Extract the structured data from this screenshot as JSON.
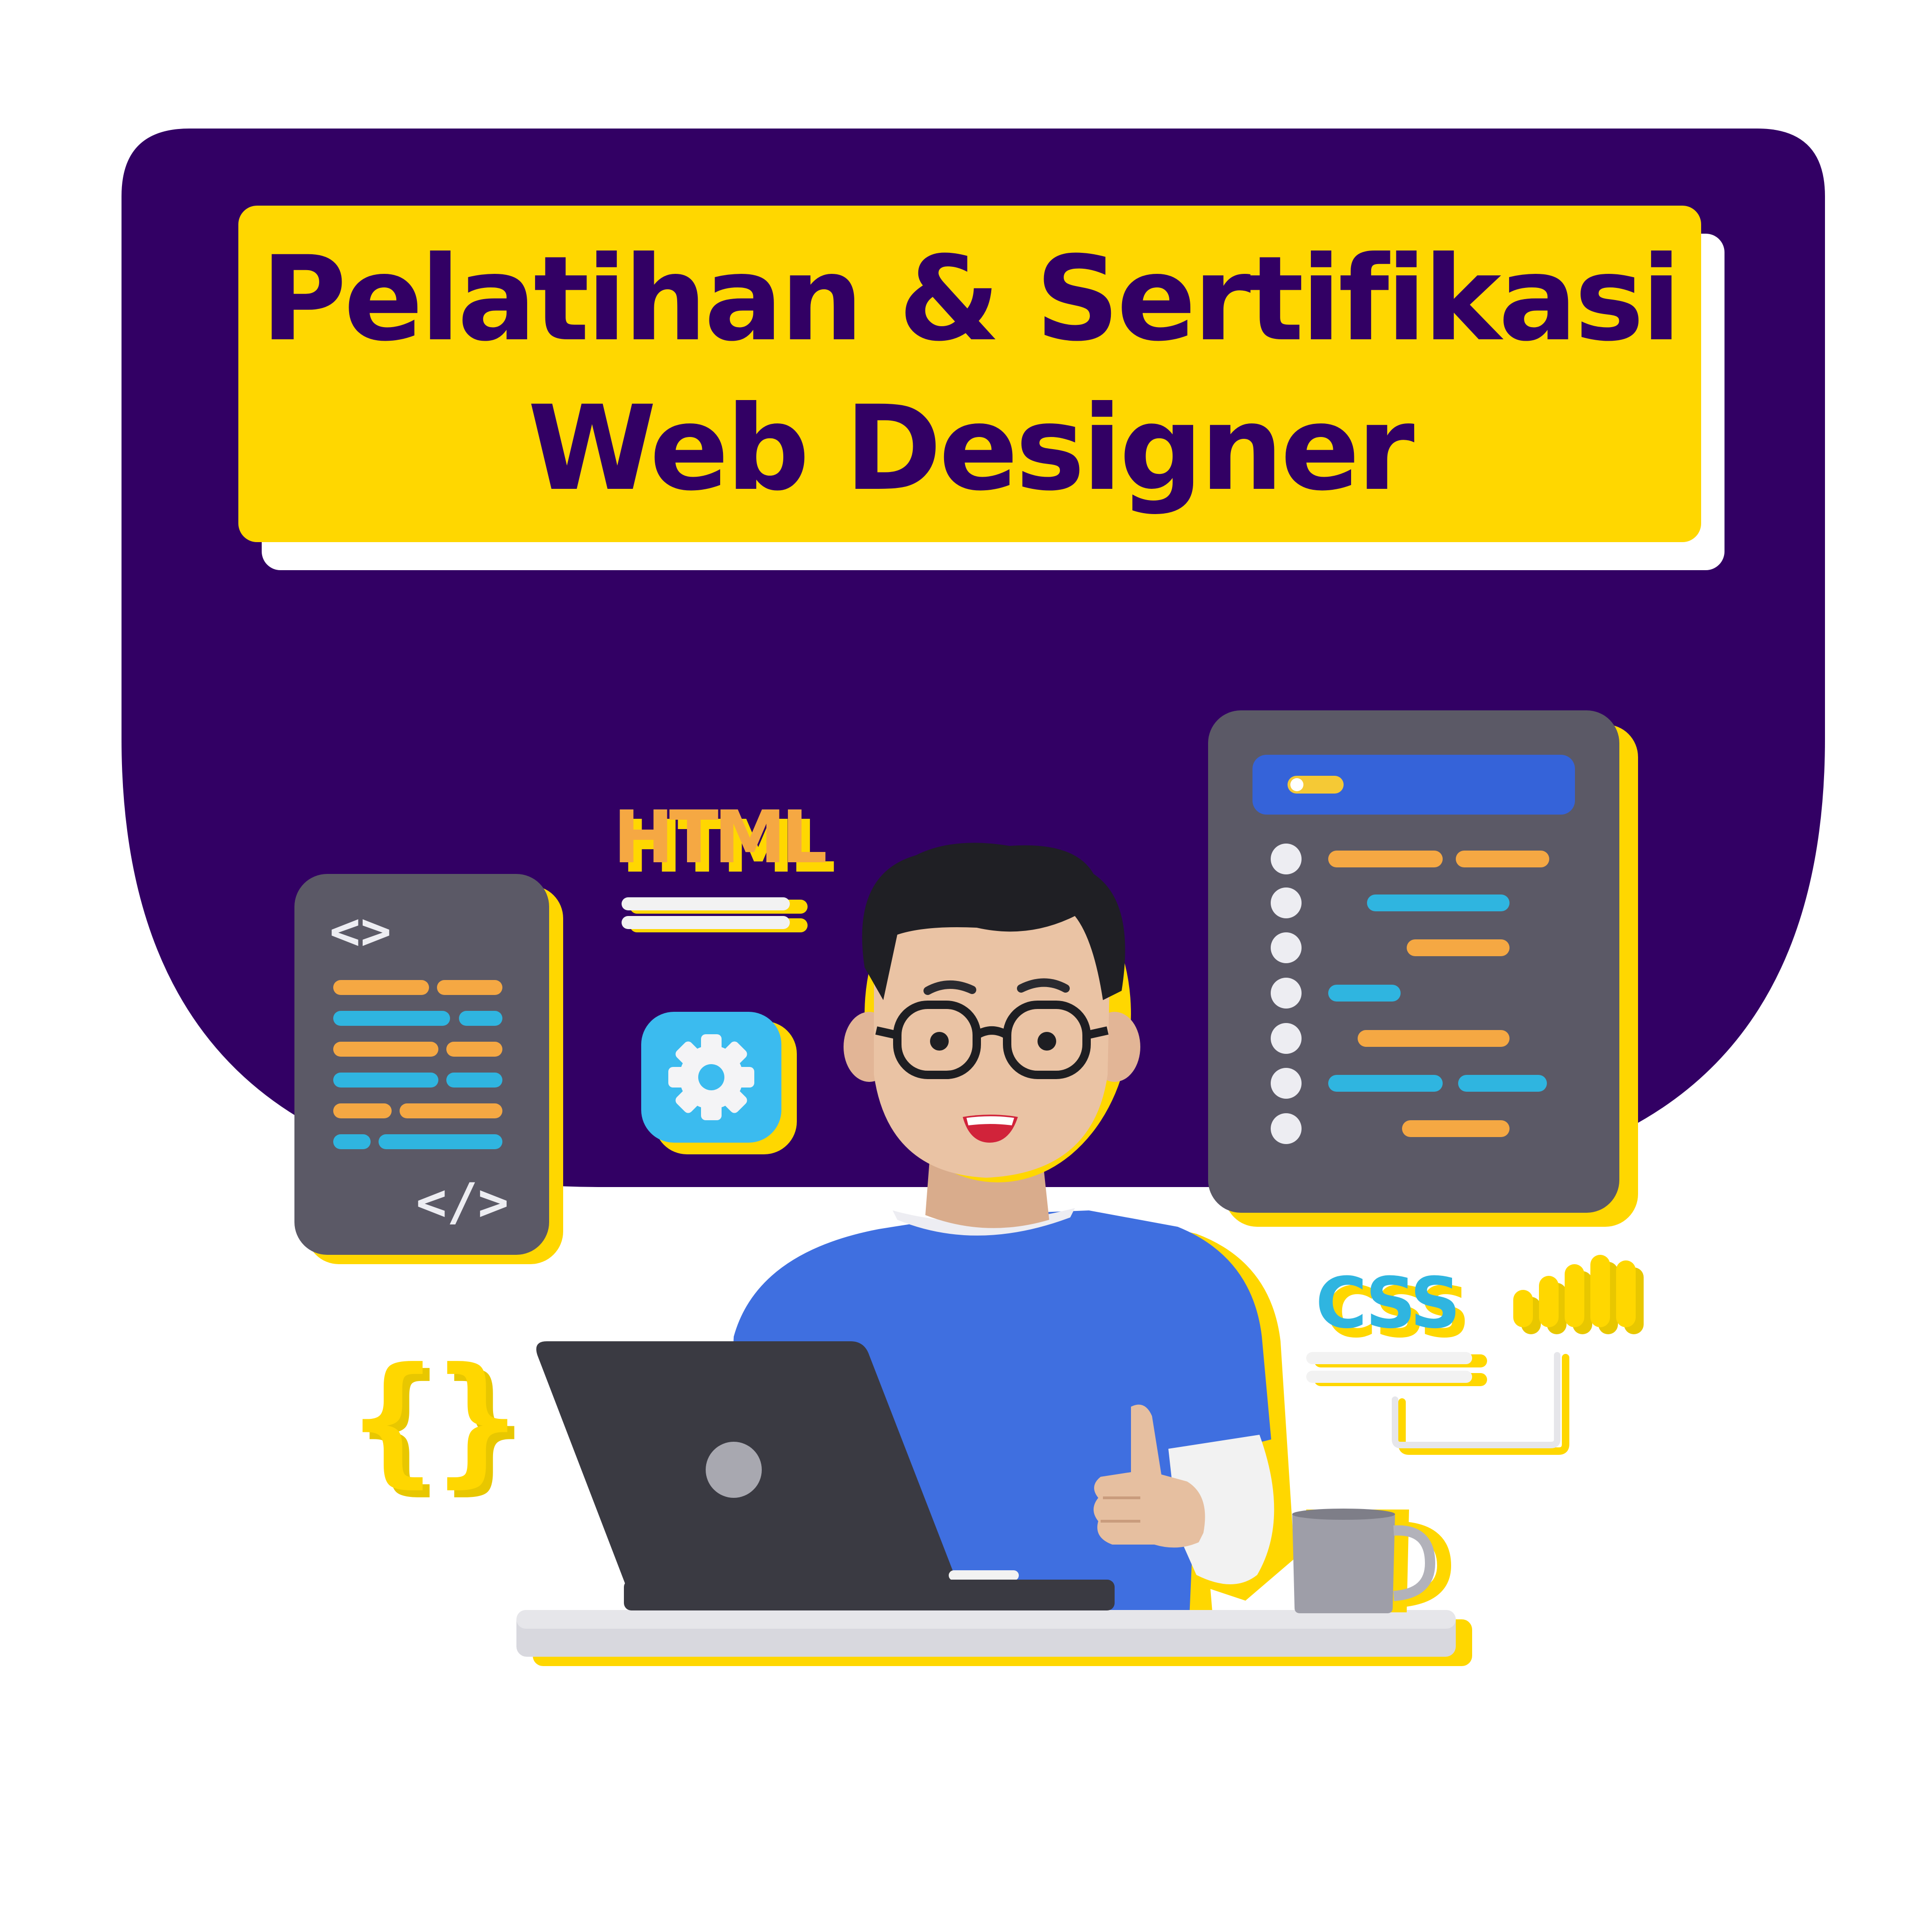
{
  "title": {
    "line1": "Pelatihan & Sertifikasi",
    "line2": "Web Designer"
  },
  "labels": {
    "html": "HTML",
    "css": "CSS",
    "left_code_open": "<>",
    "left_code_close": "</>",
    "braces": "{}"
  },
  "colors": {
    "purple": "#320064",
    "yellow": "#FFD700",
    "orange_code": "#F5A843",
    "blue_code": "#2FB5E0",
    "panel_gray": "#5B5966",
    "shirt_blue": "#3F6FE0",
    "gear_blue": "#3BBBEF",
    "laptop_dark": "#3A3A42"
  },
  "icons": {
    "gear": "gear-icon",
    "braces": "curly-braces-icon",
    "bars": "bar-chart-icon",
    "mug": "coffee-mug-icon"
  }
}
